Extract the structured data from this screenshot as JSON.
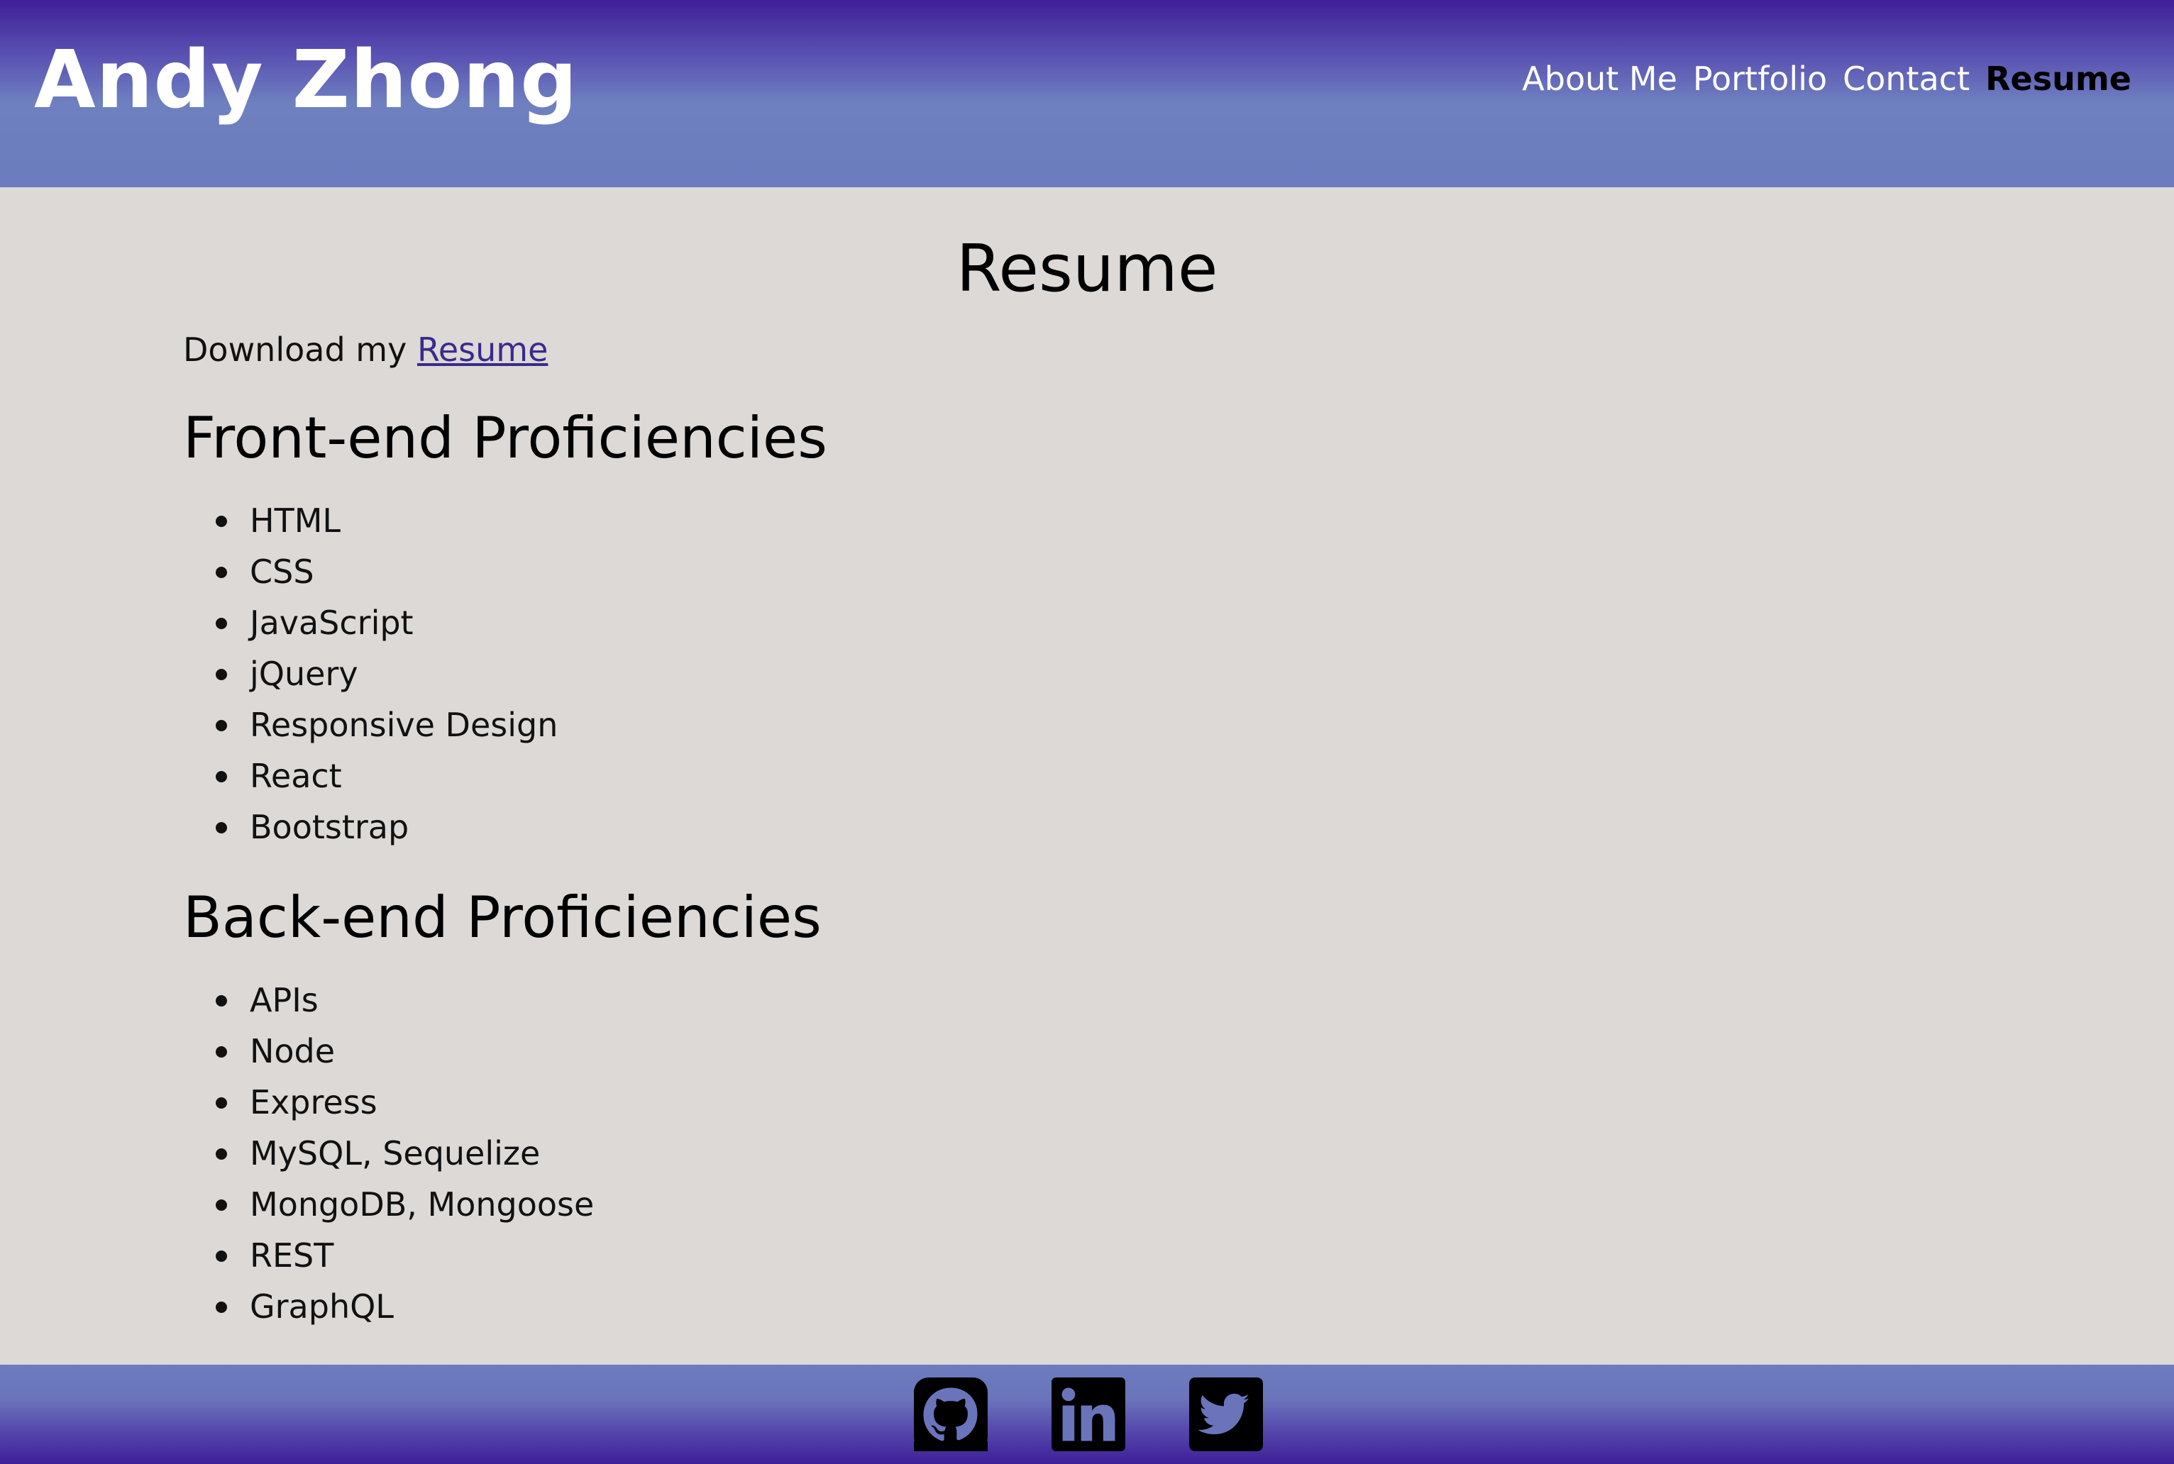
{
  "header": {
    "title": "Andy Zhong",
    "nav": [
      {
        "label": "About Me",
        "active": false
      },
      {
        "label": "Portfolio",
        "active": false
      },
      {
        "label": "Contact",
        "active": false
      },
      {
        "label": "Resume",
        "active": true
      }
    ]
  },
  "main": {
    "heading": "Resume",
    "download_prefix": "Download my",
    "download_link": "Resume",
    "frontend": {
      "heading": "Front-end Proficiencies",
      "items": [
        "HTML",
        "CSS",
        "JavaScript",
        "jQuery",
        "Responsive Design",
        "React",
        "Bootstrap"
      ]
    },
    "backend": {
      "heading": "Back-end Proficiencies",
      "items": [
        "APIs",
        "Node",
        "Express",
        "MySQL, Sequelize",
        "MongoDB, Mongoose",
        "REST",
        "GraphQL"
      ]
    }
  },
  "footer": {
    "icons": [
      "github-icon",
      "linkedin-icon",
      "twitter-icon"
    ]
  },
  "colors": {
    "header_top": "#3f1f98",
    "header_bottom": "#6c7cbe",
    "background": "#dcd9d6",
    "link": "#3b2a8c"
  }
}
